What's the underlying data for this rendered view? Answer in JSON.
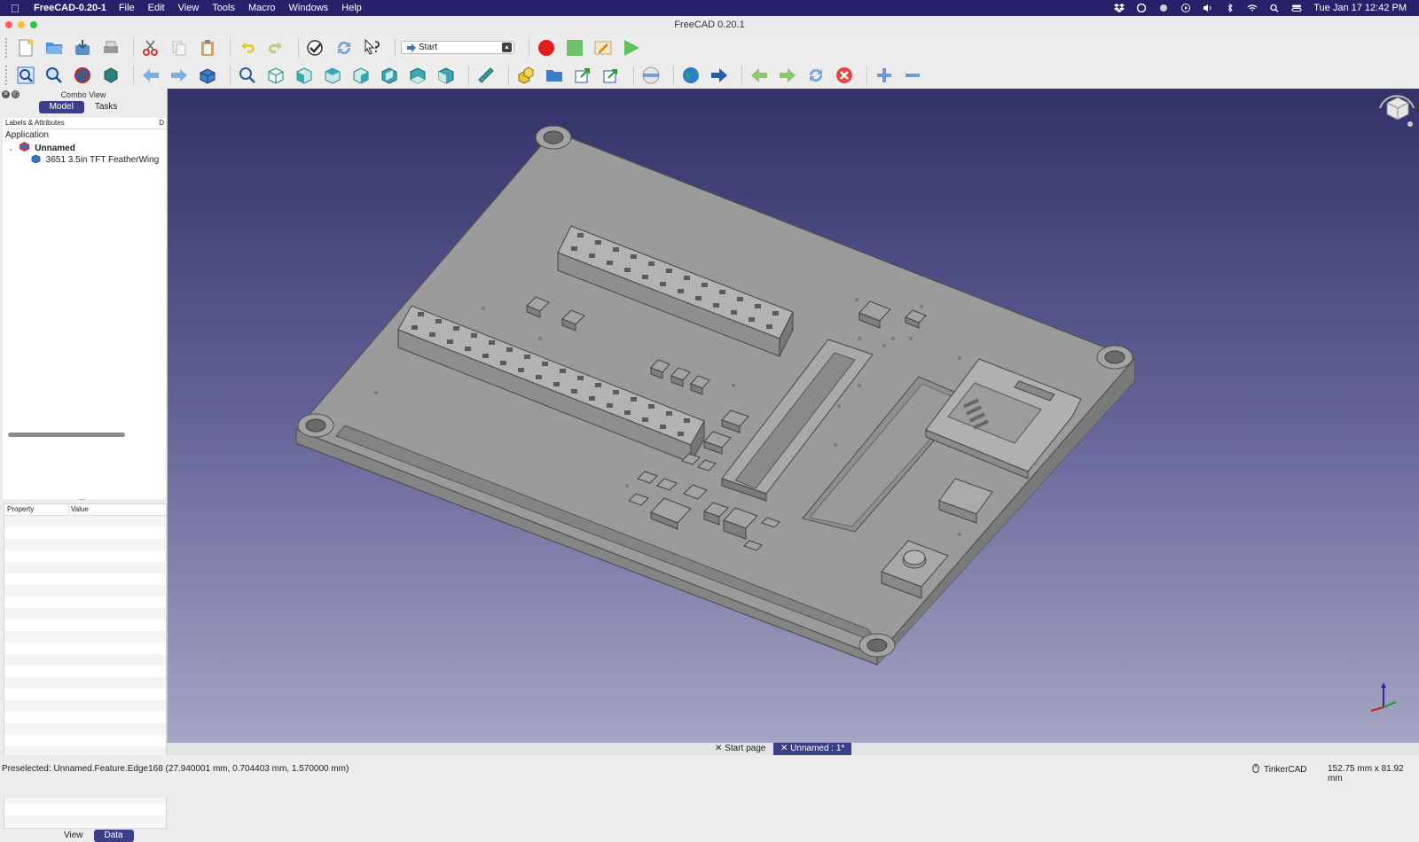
{
  "menubar": {
    "app_name": "FreeCAD-0.20-1",
    "menus": [
      "File",
      "Edit",
      "View",
      "Tools",
      "Macro",
      "Windows",
      "Help"
    ],
    "clock": "Tue Jan 17  12:42 PM"
  },
  "window": {
    "title": "FreeCAD 0.20.1"
  },
  "toolbar": {
    "workbench_selected": "Start"
  },
  "combo_view": {
    "title": "Combo View",
    "tabs": [
      "Model",
      "Tasks"
    ],
    "tree_header": "Labels & Attributes",
    "tree_header_col2": "D",
    "root_label": "Application",
    "document_label": "Unnamed",
    "object_label": "3651 3.5in TFT FeatherWing",
    "property_headers": [
      "Property",
      "Value"
    ],
    "bottom_tabs": [
      "View",
      "Data"
    ]
  },
  "doc_tabs": [
    "Start page",
    "Unnamed : 1*"
  ],
  "status": {
    "message": "Preselected: Unnamed.Feature.Edge168 (27.940001 mm, 0.704403 mm, 1.570000 mm)",
    "nav_style": "TinkerCAD",
    "dimensions": "152.75 mm x 81.92 mm"
  }
}
